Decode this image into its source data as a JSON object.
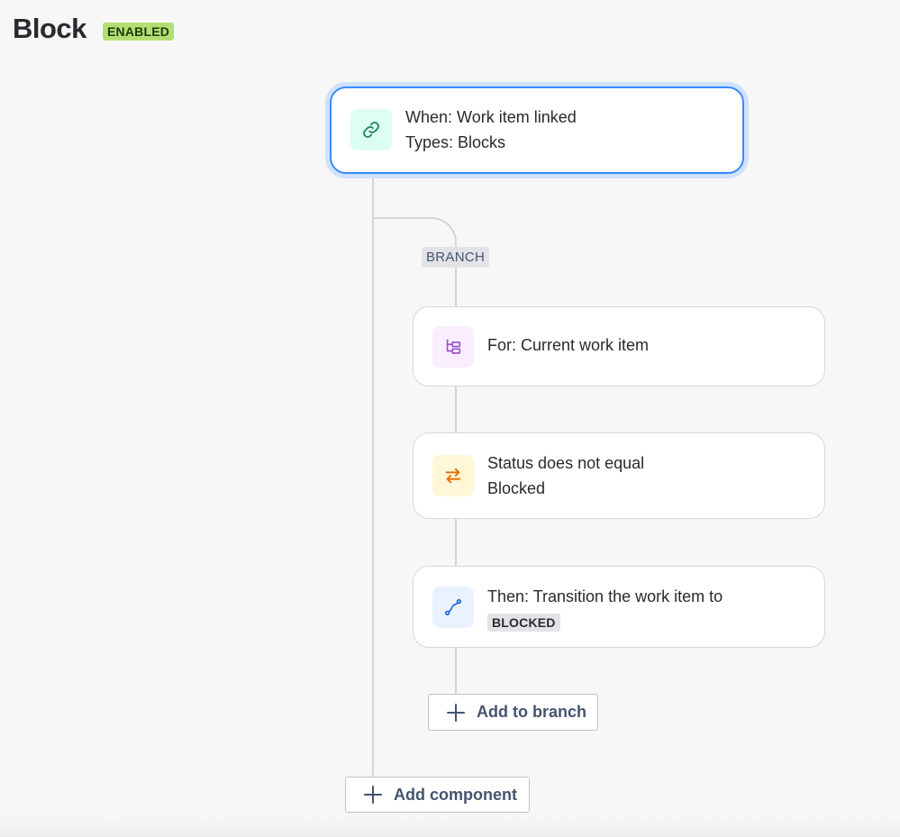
{
  "header": {
    "title": "Block",
    "status": "ENABLED"
  },
  "trigger": {
    "icon": "link-icon",
    "line1": "When: Work item linked",
    "line2": "Types: Blocks"
  },
  "branch": {
    "tag": "BRANCH",
    "steps": [
      {
        "icon": "hierarchy-icon",
        "line1": "For: Current work item"
      },
      {
        "icon": "swap-arrows-icon",
        "line1": "Status does not equal",
        "line2": "Blocked"
      },
      {
        "icon": "transition-icon",
        "line1": "Then: Transition the work item to",
        "status_lozenge": "BLOCKED"
      }
    ],
    "add_button": "Add to branch"
  },
  "add_component_button": "Add component",
  "colors": {
    "accent": "#388bff",
    "enabled_lozenge": "#b3df72",
    "link_icon_bg": "#dcfff1",
    "hierarchy_icon_bg": "#f8eefe",
    "swap_icon_bg": "#fff7d6",
    "transition_icon_bg": "#e9f2fe"
  }
}
